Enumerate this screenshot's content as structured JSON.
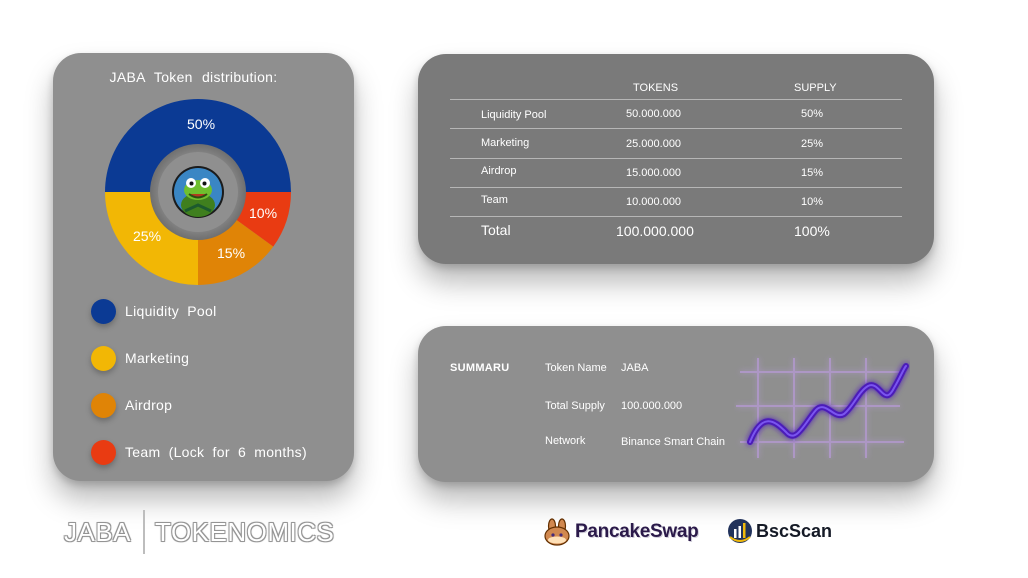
{
  "distribution": {
    "title": "JABA  Token  distribution:",
    "slices": [
      {
        "name": "Liquidity Pool",
        "percent": 50,
        "label": "50%",
        "color": "#0b3a94"
      },
      {
        "name": "Team",
        "percent": 10,
        "label": "10%",
        "color": "#e93b12"
      },
      {
        "name": "Airdrop",
        "percent": 15,
        "label": "15%",
        "color": "#e08406"
      },
      {
        "name": "Marketing",
        "percent": 25,
        "label": "25%",
        "color": "#f2b705"
      }
    ],
    "legend": [
      {
        "label": "Liquidity  Pool",
        "color": "#0b3a94"
      },
      {
        "label": "Marketing",
        "color": "#f2b705"
      },
      {
        "label": "Airdrop",
        "color": "#e08406"
      },
      {
        "label": "Team  (Lock  for  6  months)",
        "color": "#e93b12"
      }
    ]
  },
  "table": {
    "headers": {
      "tokens": "TOKENS",
      "supply": "SUPPLY"
    },
    "rows": [
      {
        "name": "Liquidity  Pool",
        "tokens": "50.000.000",
        "supply": "50%"
      },
      {
        "name": "Marketing",
        "tokens": "25.000.000",
        "supply": "25%"
      },
      {
        "name": "Airdrop",
        "tokens": "15.000.000",
        "supply": "15%"
      },
      {
        "name": "Team",
        "tokens": "10.000.000",
        "supply": "10%"
      }
    ],
    "total": {
      "name": "Total",
      "tokens": "100.000.000",
      "supply": "100%"
    }
  },
  "summary": {
    "title": "SUMMARU",
    "token_name_key": "Token Name",
    "token_name_value": "JABA",
    "total_supply_key": "Total Supply",
    "total_supply_value": "100.000.000",
    "network_key": "Network",
    "network_value": "Binance Smart Chain"
  },
  "footer": {
    "brand_left": "JABA",
    "brand_right": "TOKENOMICS",
    "pancakeswap": "PancakeSwap",
    "bscscan": "BscScan"
  },
  "icons": {
    "avatar": "frog-avatar-icon",
    "trend": "trend-line-icon",
    "pancakeswap": "bunny-icon",
    "bscscan": "bscscan-logo-icon"
  }
}
